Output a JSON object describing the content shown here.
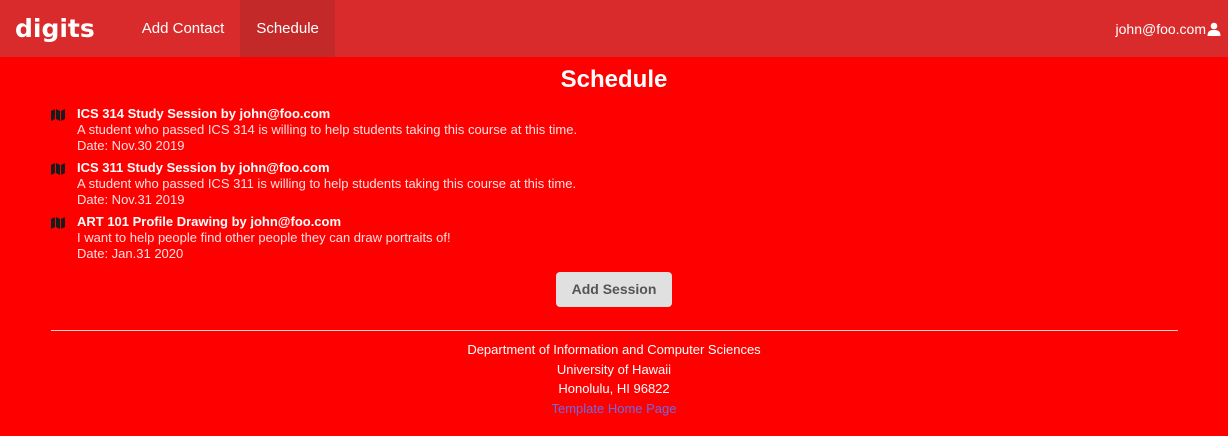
{
  "navbar": {
    "brand": "digits",
    "items": [
      {
        "label": "Add Contact"
      },
      {
        "label": "Schedule"
      }
    ],
    "user": "john@foo.com"
  },
  "page_title": "Schedule",
  "sessions": [
    {
      "title": "ICS 314 Study Session by john@foo.com",
      "description": "A student who passed ICS 314 is willing to help students taking this course at this time.",
      "date": "Date: Nov.30 2019",
      "icon": "map-icon"
    },
    {
      "title": "ICS 311 Study Session by john@foo.com",
      "description": "A student who passed ICS 311 is willing to help students taking this course at this time.",
      "date": "Date: Nov.31 2019",
      "icon": "map-icon"
    },
    {
      "title": "ART 101 Profile Drawing by john@foo.com",
      "description": "I want to help people find other people they can draw portraits of!",
      "date": "Date: Jan.31 2020",
      "icon": "map-icon"
    }
  ],
  "add_session_label": "Add Session",
  "footer": {
    "line1": "Department of Information and Computer Sciences",
    "line2": "University of Hawaii",
    "line3": "Honolulu, HI 96822",
    "link": "Template Home Page"
  },
  "colors": {
    "page_bg": "#ff0000",
    "navbar_bg": "#d92b2b",
    "active_tab_bg": "#c32929",
    "button_bg": "#e0e0e0",
    "link": "#6b6be0"
  }
}
